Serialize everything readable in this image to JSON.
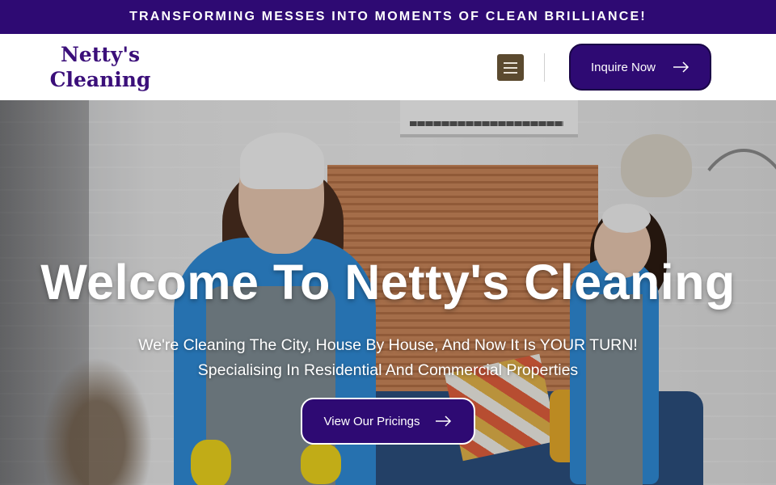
{
  "topbar": {
    "announcement": "TRANSFORMING MESSES INTO MOMENTS OF CLEAN BRILLIANCE!",
    "background_color": "#2e0a73"
  },
  "header": {
    "logo_line1": "Netty's",
    "logo_line2": "Cleaning",
    "logo_color": "#3b0f7a",
    "menu_icon": "hamburger-menu-icon",
    "inquire_label": "Inquire Now",
    "inquire_icon": "arrow-right-icon"
  },
  "hero": {
    "title": "Welcome To Netty's Cleaning",
    "subtitle_line1": "We're Cleaning The City, House By House, And Now It Is YOUR TURN!",
    "subtitle_line2": "Specialising In Residential And Commercial Properties",
    "cta_label": "View Our Pricings",
    "cta_icon": "arrow-right-icon",
    "accent_color": "#2e0a73"
  }
}
